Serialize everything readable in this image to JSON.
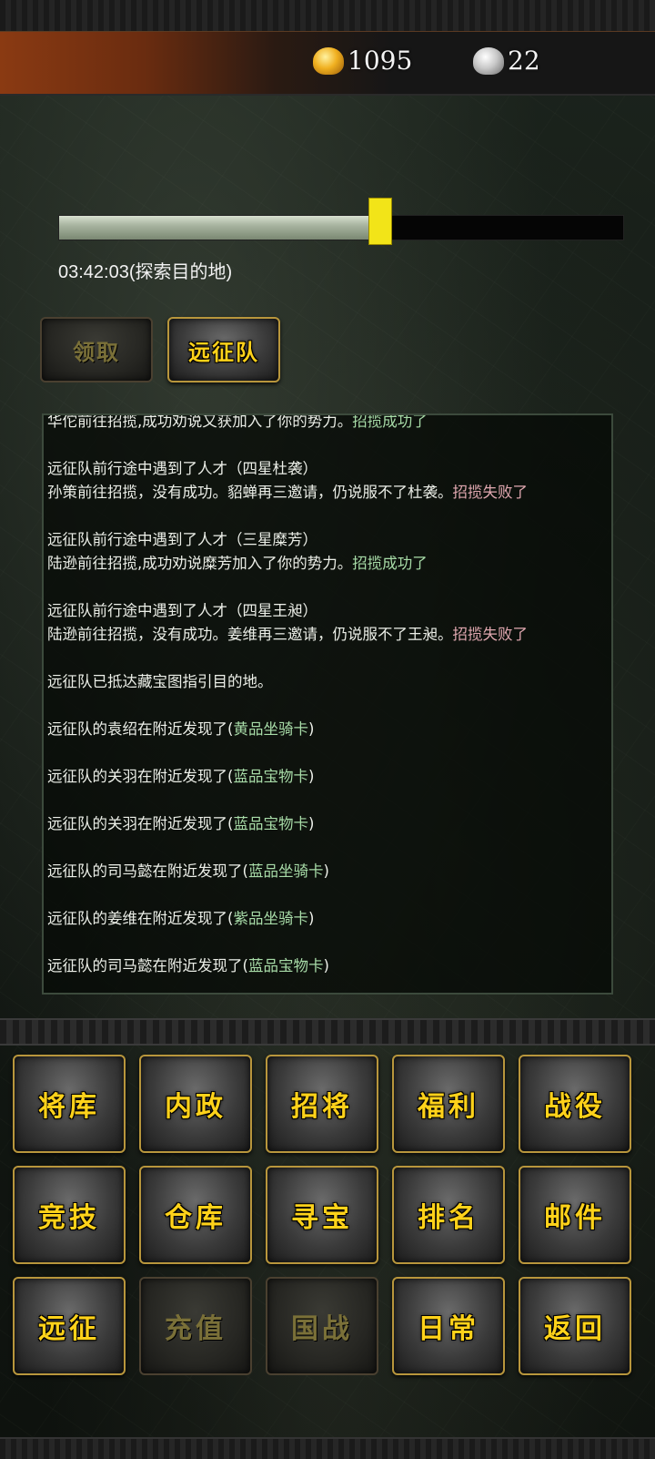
{
  "resources": {
    "gold": "1095",
    "silver": "22"
  },
  "expedition": {
    "progress": 0.59,
    "status_text": "03:42:03(探索目的地)"
  },
  "buttons": {
    "claim": "领取",
    "team": "远征队"
  },
  "log": [
    {
      "type": "line",
      "parts": [
        {
          "t": "华佗前往招揽,成功劝说又获加入了你的势力。",
          "c": ""
        },
        {
          "t": "招揽成功了",
          "c": "ok"
        }
      ]
    },
    {
      "type": "gap"
    },
    {
      "type": "line",
      "parts": [
        {
          "t": "远征队前行途中遇到了人才（四星杜袭）",
          "c": ""
        }
      ]
    },
    {
      "type": "line",
      "parts": [
        {
          "t": "孙策前往招揽，没有成功。貂蝉再三邀请，仍说服不了杜袭。",
          "c": ""
        },
        {
          "t": "招揽失败了",
          "c": "fail"
        }
      ]
    },
    {
      "type": "gap"
    },
    {
      "type": "line",
      "parts": [
        {
          "t": "远征队前行途中遇到了人才（三星糜芳）",
          "c": ""
        }
      ]
    },
    {
      "type": "line",
      "parts": [
        {
          "t": "陆逊前往招揽,成功劝说糜芳加入了你的势力。",
          "c": ""
        },
        {
          "t": "招揽成功了",
          "c": "ok"
        }
      ]
    },
    {
      "type": "gap"
    },
    {
      "type": "line",
      "parts": [
        {
          "t": "远征队前行途中遇到了人才（四星王昶）",
          "c": ""
        }
      ]
    },
    {
      "type": "line",
      "parts": [
        {
          "t": "陆逊前往招揽，没有成功。姜维再三邀请，仍说服不了王昶。",
          "c": ""
        },
        {
          "t": "招揽失败了",
          "c": "fail"
        }
      ]
    },
    {
      "type": "gap"
    },
    {
      "type": "line",
      "parts": [
        {
          "t": "远征队已抵达藏宝图指引目的地。",
          "c": ""
        }
      ]
    },
    {
      "type": "gap"
    },
    {
      "type": "line",
      "parts": [
        {
          "t": "远征队的袁绍在附近发现了(",
          "c": ""
        },
        {
          "t": "黄品坐骑卡",
          "c": "item"
        },
        {
          "t": ")",
          "c": ""
        }
      ]
    },
    {
      "type": "gap"
    },
    {
      "type": "line",
      "parts": [
        {
          "t": "远征队的关羽在附近发现了(",
          "c": ""
        },
        {
          "t": "蓝品宝物卡",
          "c": "item"
        },
        {
          "t": ")",
          "c": ""
        }
      ]
    },
    {
      "type": "gap"
    },
    {
      "type": "line",
      "parts": [
        {
          "t": "远征队的关羽在附近发现了(",
          "c": ""
        },
        {
          "t": "蓝品宝物卡",
          "c": "item"
        },
        {
          "t": ")",
          "c": ""
        }
      ]
    },
    {
      "type": "gap"
    },
    {
      "type": "line",
      "parts": [
        {
          "t": "远征队的司马懿在附近发现了(",
          "c": ""
        },
        {
          "t": "蓝品坐骑卡",
          "c": "item"
        },
        {
          "t": ")",
          "c": ""
        }
      ]
    },
    {
      "type": "gap"
    },
    {
      "type": "line",
      "parts": [
        {
          "t": "远征队的姜维在附近发现了(",
          "c": ""
        },
        {
          "t": "紫品坐骑卡",
          "c": "item"
        },
        {
          "t": ")",
          "c": ""
        }
      ]
    },
    {
      "type": "gap"
    },
    {
      "type": "line",
      "parts": [
        {
          "t": "远征队的司马懿在附近发现了(",
          "c": ""
        },
        {
          "t": "蓝品宝物卡",
          "c": "item"
        },
        {
          "t": ")",
          "c": ""
        }
      ]
    }
  ],
  "menu": [
    {
      "label": "将库",
      "enabled": true
    },
    {
      "label": "内政",
      "enabled": true
    },
    {
      "label": "招将",
      "enabled": true
    },
    {
      "label": "福利",
      "enabled": true
    },
    {
      "label": "战役",
      "enabled": true
    },
    {
      "label": "竞技",
      "enabled": true
    },
    {
      "label": "仓库",
      "enabled": true
    },
    {
      "label": "寻宝",
      "enabled": true
    },
    {
      "label": "排名",
      "enabled": true
    },
    {
      "label": "邮件",
      "enabled": true
    },
    {
      "label": "远征",
      "enabled": true
    },
    {
      "label": "充值",
      "enabled": false
    },
    {
      "label": "国战",
      "enabled": false
    },
    {
      "label": "日常",
      "enabled": true
    },
    {
      "label": "返回",
      "enabled": true
    }
  ]
}
